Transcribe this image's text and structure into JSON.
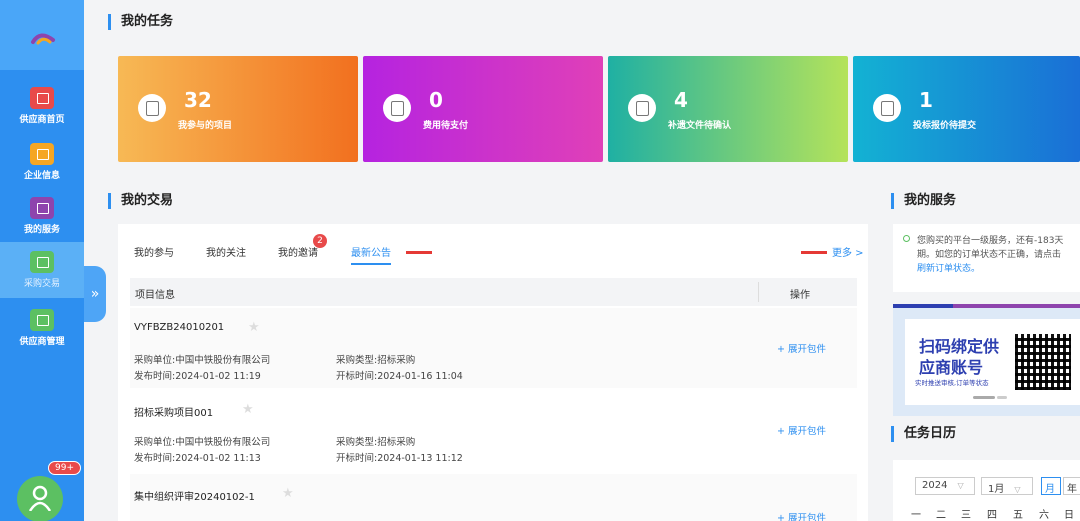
{
  "sidebar": {
    "items": [
      {
        "label": "供应商首页",
        "color": "#e84a4a"
      },
      {
        "label": "企业信息",
        "color": "#f5a623"
      },
      {
        "label": "我的服务",
        "color": "#8e44ad"
      },
      {
        "label": "采购交易",
        "color": "#5cc062"
      },
      {
        "label": "供应商管理",
        "color": "#5cc062"
      }
    ],
    "toggle_glyph": "»",
    "notification_badge": "99+"
  },
  "tasks": {
    "title": "我的任务",
    "cards": [
      {
        "num": "32",
        "label": "我参与的项目"
      },
      {
        "num": "0",
        "label": "费用待支付"
      },
      {
        "num": "4",
        "label": "补遗文件待确认"
      },
      {
        "num": "1",
        "label": "投标报价待提交"
      }
    ]
  },
  "trade": {
    "title": "我的交易",
    "tabs": [
      "我的参与",
      "我的关注",
      "我的邀请",
      "最新公告"
    ],
    "invite_badge": "2",
    "more_label": "更多 >",
    "col_info": "项目信息",
    "col_action": "操作",
    "rows": [
      {
        "name": "VYFBZB24010201",
        "buyer": "采购单位:中国中铁股份有限公司",
        "type": "采购类型:招标采购",
        "publish": "发布时间:2024-01-02 11:19",
        "open": "开标时间:2024-01-16 11:04",
        "action": "+ 展开包件"
      },
      {
        "name": "招标采购项目001",
        "buyer": "采购单位:中国中铁股份有限公司",
        "type": "采购类型:招标采购",
        "publish": "发布时间:2024-01-02 11:13",
        "open": "开标时间:2024-01-13 11:12",
        "action": "+ 展开包件"
      },
      {
        "name": "集中组织评审20240102-1",
        "buyer": "",
        "type": "",
        "publish": "",
        "open": "",
        "action": "+ 展开包件"
      }
    ]
  },
  "services": {
    "title": "我的服务",
    "line1": "您购买的平台一级服务，还有-183天",
    "line2": "期。如您的订单状态不正确，请点击",
    "line3": "刷新订单状态。"
  },
  "promo": {
    "line1": "扫码绑定供",
    "line2": "应商账号",
    "line3": "实时推送审核,订单等状态"
  },
  "calendar": {
    "title": "任务日历",
    "year": "2024",
    "month": "1月",
    "mode_month": "月",
    "mode_year": "年",
    "weekdays": [
      "一",
      "二",
      "三",
      "四",
      "五",
      "六",
      "日"
    ]
  }
}
